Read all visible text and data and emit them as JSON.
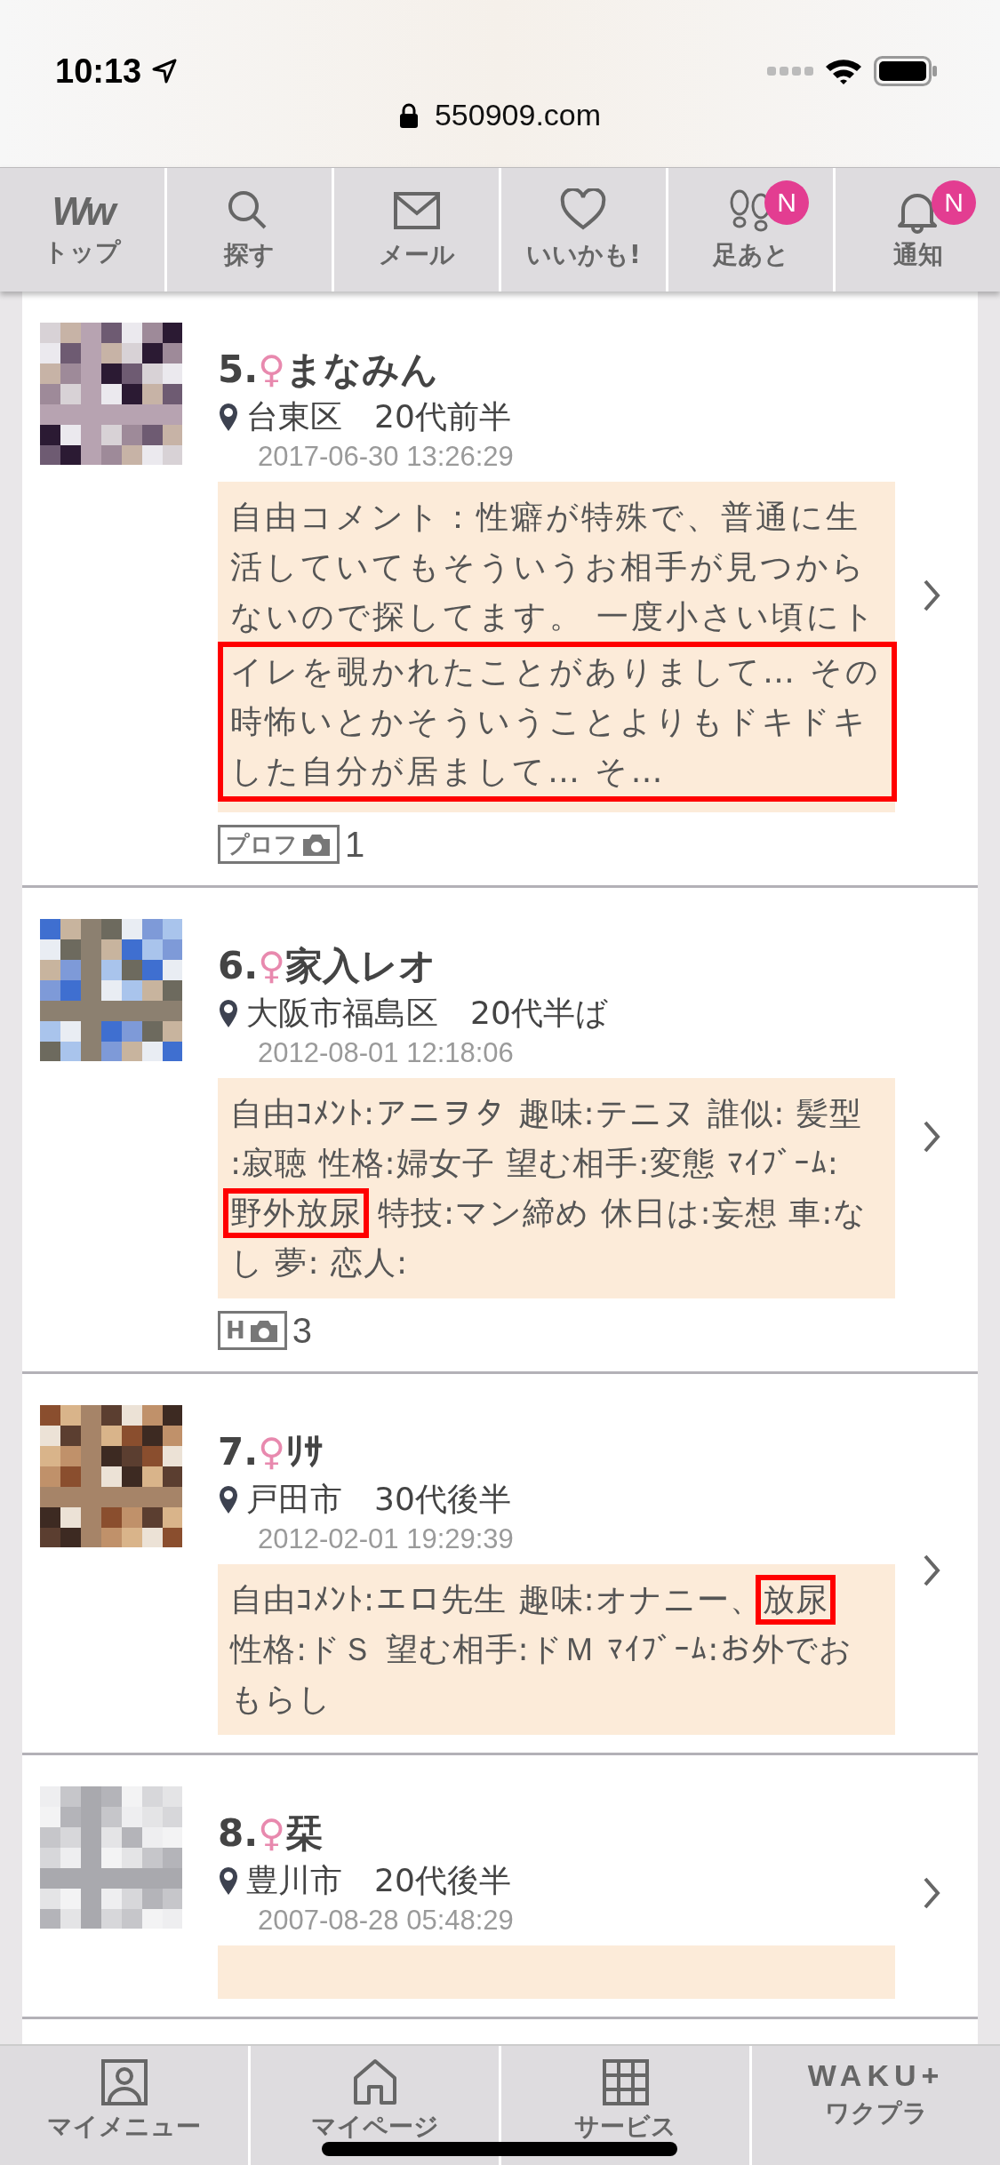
{
  "status_bar": {
    "time": "10:13",
    "url": "550909.com"
  },
  "nav_tabs": [
    {
      "kind": "logo",
      "logo": "Ww",
      "label": "トップ"
    },
    {
      "kind": "search",
      "label": "探す"
    },
    {
      "kind": "mail",
      "label": "メール"
    },
    {
      "kind": "heart",
      "label": "いいかも!"
    },
    {
      "kind": "footprints",
      "label": "足あと",
      "badge": "N"
    },
    {
      "kind": "bell",
      "label": "通知",
      "badge": "N"
    }
  ],
  "profiles": [
    {
      "number": "5.",
      "gender": "♀",
      "name": "まなみん",
      "location": "台東区",
      "age": "20代前半",
      "date": "2017-06-30 13:26:29",
      "comment": [
        {
          "text": "自由コメント：性癖が特殊で、普通に生活していてもそういうお相手が見つからないので探してます。 一度小さい頃にト",
          "kind": "block",
          "boxed": false
        },
        {
          "text": "イレを覗かれたことがありまして… その時怖いとかそういうことよりもドキドキした自分が居まして… そ…",
          "kind": "block",
          "boxed": true
        }
      ],
      "photo_tag": "プロフ",
      "photo_count": "1"
    },
    {
      "number": "6.",
      "gender": "♀",
      "name": "家入レオ",
      "location": "大阪市福島区",
      "age": "20代半ば",
      "date": "2012-08-01 12:18:06",
      "comment": [
        {
          "text": "自由ｺﾒﾝﾄ:アニヲタ 趣味:テニヌ 誰似: 髪型",
          "kind": "line",
          "boxed": false
        },
        {
          "text": ":寂聴 性格:婦女子 望む相手:変態 ﾏｲﾌﾞｰﾑ:",
          "kind": "line",
          "boxed": false
        },
        {
          "text": "野外放尿",
          "kind": "line",
          "boxed": true
        },
        {
          "text": "特技:マン締め 休日は:妄想 車:な",
          "kind": "inline",
          "boxed": false
        },
        {
          "text": "し 夢: 恋人:",
          "kind": "line",
          "boxed": false
        }
      ],
      "photo_tag": "H",
      "photo_count": "3"
    },
    {
      "number": "7.",
      "gender": "♀",
      "name": "ﾘｻ",
      "location": "戸田市",
      "age": "30代後半",
      "date": "2012-02-01 19:29:39",
      "comment": [
        {
          "text": "自由ｺﾒﾝﾄ:エロ先生 趣味:オナニー、",
          "kind": "line",
          "boxed": false
        },
        {
          "text": "放尿",
          "kind": "inline",
          "boxed": true
        },
        {
          "text": "性格:ドＳ 望む相手:ドＭ ﾏｲﾌﾞｰﾑ:お外でお",
          "kind": "line",
          "boxed": false
        },
        {
          "text": "もらし",
          "kind": "line",
          "boxed": false
        }
      ]
    },
    {
      "number": "8.",
      "gender": "♀",
      "name": "栞",
      "location": "豊川市",
      "age": "20代後半",
      "date": "2007-08-28 05:48:29"
    }
  ],
  "bottom_tabs": [
    {
      "kind": "person",
      "label": "マイメニュー"
    },
    {
      "kind": "home",
      "label": "マイページ"
    },
    {
      "kind": "grid",
      "label": "サービス"
    },
    {
      "kind": "logo",
      "logo": "WAKU+",
      "label": "ワクプラ"
    }
  ]
}
